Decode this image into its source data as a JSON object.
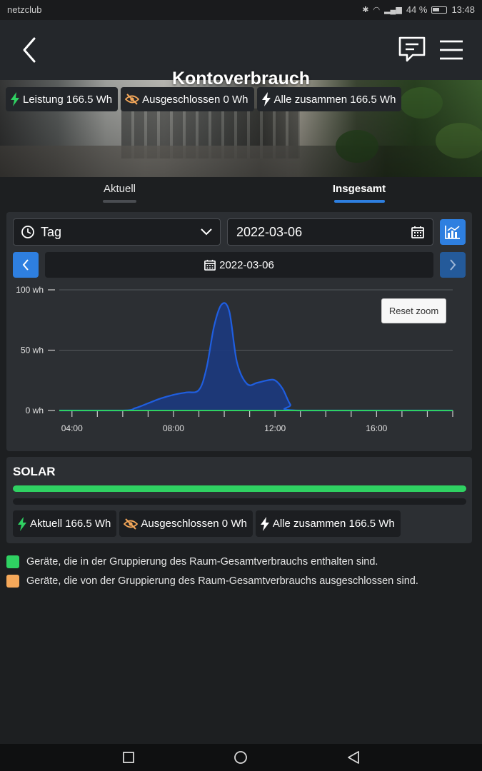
{
  "status_bar": {
    "app_name": "netzclub",
    "battery": "44 %",
    "time": "13:48",
    "icons": [
      "bluetooth-icon",
      "wifi-icon",
      "signal-icon",
      "battery-icon"
    ]
  },
  "header": {
    "back_icon": "chevron-left-icon",
    "chat_icon": "message-icon",
    "menu_icon": "hamburger-menu-icon"
  },
  "hero": {
    "title": "Kontoverbrauch",
    "pills": [
      {
        "icon": "bolt-icon",
        "text": "Leistung 166.5 Wh"
      },
      {
        "icon": "eye-slash-icon",
        "text": "Ausgeschlossen 0 Wh"
      },
      {
        "icon": "bolt-icon",
        "text": "Alle zusammen 166.5 Wh"
      }
    ]
  },
  "tabs": [
    {
      "label": "Aktuell",
      "active": false
    },
    {
      "label": "Insgesamt",
      "active": true
    }
  ],
  "controls": {
    "period_select": "Tag",
    "date_input": "2022-03-06",
    "date_strip": "2022-03-06",
    "reset_zoom": "Reset zoom"
  },
  "chart_data": {
    "type": "area",
    "x_unit": "time of day (hours)",
    "x_tick_labels": [
      "04:00",
      "08:00",
      "12:00",
      "16:00"
    ],
    "y_tick_labels": [
      "100 wh",
      "50 wh",
      "0 wh"
    ],
    "ylim": [
      0,
      100
    ],
    "xlim": [
      3.5,
      19
    ],
    "series": [
      {
        "color": "#1f5ee0",
        "x": [
          3.5,
          6.0,
          6.5,
          7.0,
          7.5,
          8.0,
          8.5,
          9.0,
          9.3,
          9.6,
          9.9,
          10.2,
          10.5,
          10.9,
          11.3,
          11.7,
          12.0,
          12.3,
          12.6,
          12.9,
          19.0
        ],
        "y": [
          0,
          0,
          2,
          6,
          10,
          13,
          15,
          17,
          35,
          70,
          88,
          82,
          40,
          22,
          23,
          25,
          25,
          18,
          5,
          0,
          0
        ]
      },
      {
        "color": "#2fd162",
        "x": [
          3.5,
          19.0
        ],
        "y": [
          0,
          0
        ]
      }
    ],
    "grid": true,
    "legend": "none"
  },
  "solar": {
    "title": "SOLAR",
    "included_fraction": 1.0,
    "pills": [
      {
        "icon": "bolt-icon",
        "text": "Aktuell 166.5 Wh"
      },
      {
        "icon": "eye-slash-icon",
        "text": "Ausgeschlossen 0 Wh"
      },
      {
        "icon": "bolt-icon",
        "text": "Alle zusammen 166.5 Wh"
      }
    ]
  },
  "legend": [
    {
      "color": "#2fd162",
      "text": "Geräte, die in der Gruppierung des Raum-Gesamtverbrauchs enthalten sind."
    },
    {
      "color": "#f5a85a",
      "text": "Geräte, die von der Gruppierung des Raum-Gesamtverbrauchs ausgeschlossen sind."
    }
  ],
  "colors": {
    "accent": "#2e7fe0",
    "green": "#2fd162",
    "orange": "#f5a85a",
    "background": "#1d1f21"
  }
}
